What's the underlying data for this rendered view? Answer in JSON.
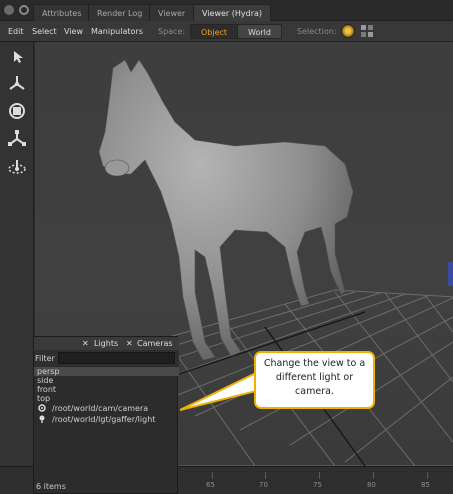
{
  "tabs": [
    {
      "label": "Attributes",
      "active": false
    },
    {
      "label": "Render Log",
      "active": false
    },
    {
      "label": "Viewer",
      "active": false
    },
    {
      "label": "Viewer (Hydra)",
      "active": true
    }
  ],
  "menu": {
    "edit": "Edit",
    "select": "Select",
    "view": "View",
    "manipulators": "Manipulators",
    "space_label": "Space:",
    "space_object": "Object",
    "space_world": "World",
    "selection_label": "Selection:"
  },
  "tools": [
    "select-arrow-icon",
    "translate-icon",
    "rotate-icon",
    "scale-icon",
    "camera-orbit-icon"
  ],
  "timeline": {
    "ticks": [
      "65",
      "70",
      "75",
      "80",
      "85"
    ]
  },
  "panel": {
    "tab_lights": "Lights",
    "tab_cameras": "Cameras",
    "filter_label": "Filter",
    "filter_value": "",
    "rows": [
      {
        "label": "persp",
        "highlight": true
      },
      {
        "label": "side",
        "highlight": false
      },
      {
        "label": "front",
        "highlight": false
      },
      {
        "label": "top",
        "highlight": false
      }
    ],
    "paths": [
      {
        "label": "/root/world/cam/camera",
        "icon": "camera-icon"
      },
      {
        "label": "/root/world/lgt/gaffer/light",
        "icon": "light-icon"
      }
    ],
    "status": "6 items"
  },
  "callout": {
    "text": "Change the view to a different light or camera."
  },
  "colors": {
    "accent": "#f0a020",
    "callout_border": "#f0b000"
  }
}
